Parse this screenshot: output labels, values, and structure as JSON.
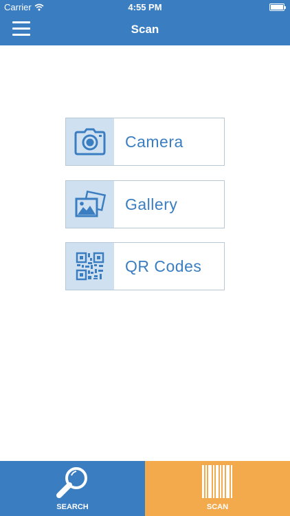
{
  "status_bar": {
    "carrier": "Carrier",
    "time": "4:55 PM"
  },
  "header": {
    "title": "Scan",
    "menu_icon": "hamburger-menu-icon"
  },
  "options": [
    {
      "label": "Camera",
      "icon": "camera-icon"
    },
    {
      "label": "Gallery",
      "icon": "gallery-icon"
    },
    {
      "label": "QR Codes",
      "icon": "qr-code-icon"
    }
  ],
  "tabs": [
    {
      "label": "SEARCH",
      "icon": "magnifier-icon",
      "color": "#3a7ec1"
    },
    {
      "label": "SCAN",
      "icon": "barcode-icon",
      "color": "#f2aa4c",
      "selected": true
    }
  ],
  "colors": {
    "primary": "#3a7ec1",
    "accent": "#f2aa4c",
    "icon_bg": "#cfe0f1"
  }
}
